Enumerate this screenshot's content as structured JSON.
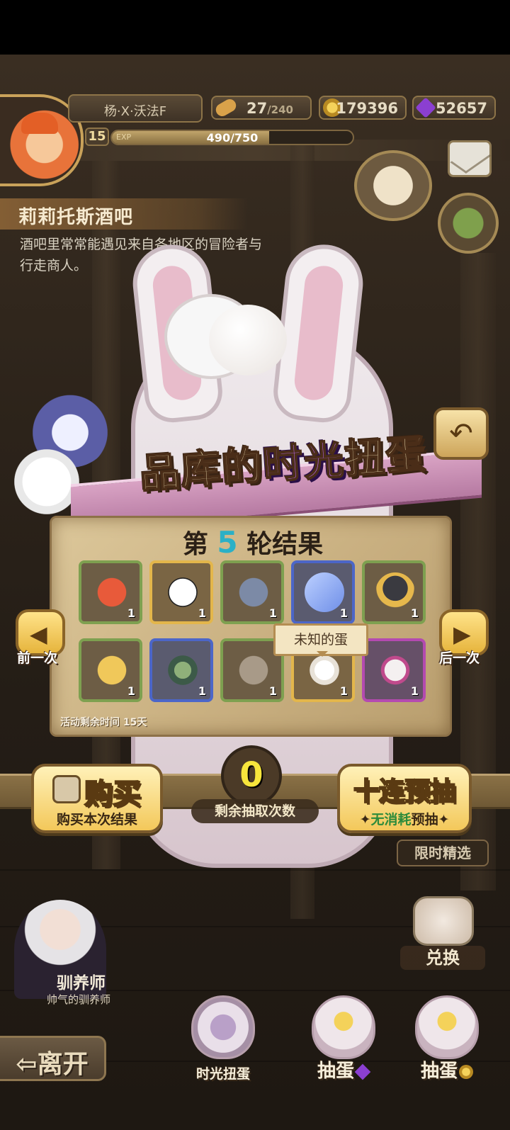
{
  "player": {
    "name": "杨·X·沃法F",
    "level": "15",
    "exp_label": "EXP",
    "exp_text": "490/750",
    "exp_fraction": 0.653
  },
  "resources": [
    {
      "name": "stamina",
      "icon": "bread-icon",
      "value": "27",
      "max": "/240",
      "color": "#d9a24a"
    },
    {
      "name": "gold",
      "icon": "gold-coin-icon",
      "value": "179396",
      "color": "#e1b43c"
    },
    {
      "name": "gem",
      "icon": "purple-gem-icon",
      "value": "52657",
      "color": "#8b3fd1"
    }
  ],
  "location": {
    "title": "莉莉托斯酒吧",
    "description": "酒吧里常常能遇见来自各地区的冒险者与行走商人。"
  },
  "event": {
    "banner": {
      "part1": "品库的",
      "highlight": "时光",
      "part2": "扭蛋"
    },
    "round": {
      "prefix": "第",
      "number": "5",
      "suffix": "轮结果"
    },
    "items": [
      {
        "icon": "crab-icon",
        "count": "1",
        "rarity": "green"
      },
      {
        "icon": "skull-icon",
        "count": "1",
        "rarity": "gold"
      },
      {
        "icon": "shell-icon",
        "count": "1",
        "rarity": "green"
      },
      {
        "icon": "crystal-icon",
        "count": "1",
        "rarity": "blue"
      },
      {
        "icon": "dark-egg-icon",
        "count": "1",
        "rarity": "green"
      },
      {
        "icon": "golden-egg-icon",
        "count": "1",
        "rarity": "green"
      },
      {
        "icon": "hooded-figure-icon",
        "count": "1",
        "rarity": "blue"
      },
      {
        "icon": "helmet-icon",
        "count": "1",
        "rarity": "green"
      },
      {
        "icon": "white-flower-icon",
        "count": "1",
        "rarity": "gold"
      },
      {
        "icon": "ghost-bow-icon",
        "count": "1",
        "rarity": "purple"
      }
    ],
    "tooltip": "未知的蛋",
    "time_left": "活动剩余时间  15天",
    "prev_label": "前一次",
    "next_label": "后一次"
  },
  "actions": {
    "buy_title": "购买",
    "buy_subtitle": "购买本次结果",
    "draws_remaining": "0",
    "draws_label": "剩余抽取次数",
    "preview_title": "十连预抽",
    "preview_sub_free": "无消耗",
    "preview_sub_rest": "预抽",
    "limited": "限时精选"
  },
  "npc": {
    "name": "驯养师",
    "title": "帅气的驯养师"
  },
  "bottom": {
    "leave": "⇦离开",
    "exchange": "兑换",
    "time_gacha": "时光扭蛋",
    "gacha_gem": "抽蛋",
    "gacha_gold": "抽蛋"
  },
  "colors": {
    "accent_purple": "#c06bff",
    "round_number": "#2bb0c6",
    "counter": "#f7e53c"
  }
}
